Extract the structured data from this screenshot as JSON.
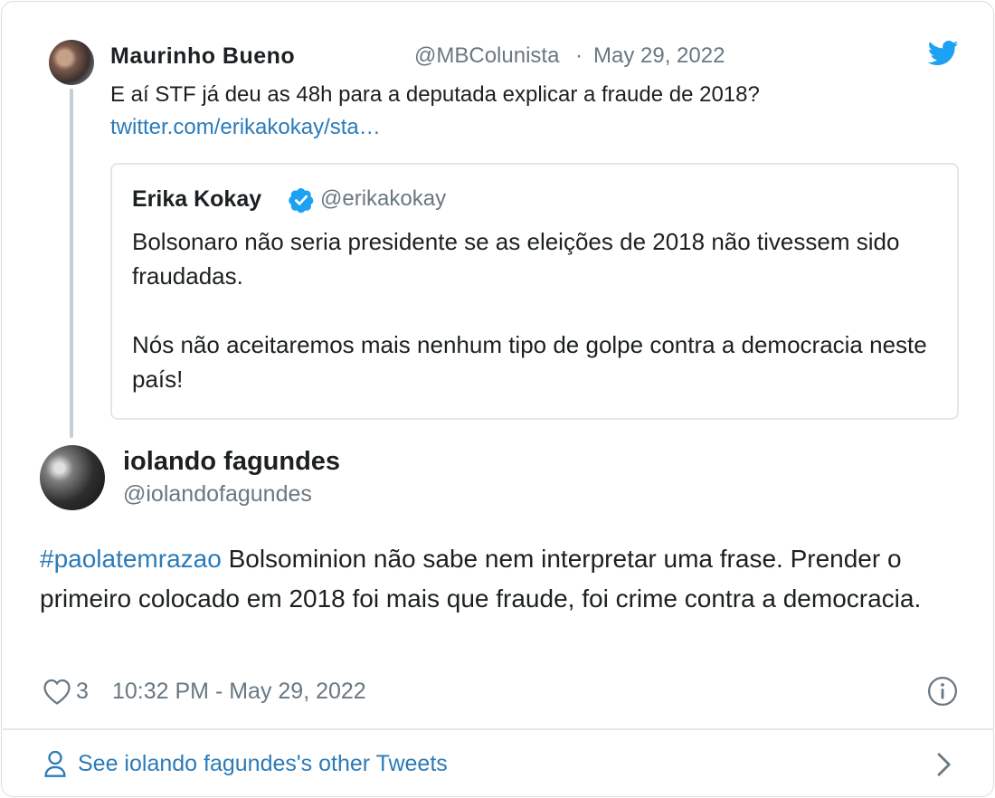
{
  "parent_tweet": {
    "author_name": "Maurinho Bueno",
    "handle": "@MBColunista",
    "separator": "·",
    "date": "May 29, 2022",
    "text": "E aí STF já deu as 48h para a deputada explicar a fraude de 2018?",
    "link": "twitter.com/erikakokay/sta…"
  },
  "quoted_tweet": {
    "author_name": "Erika Kokay",
    "handle": "@erikakokay",
    "text": "Bolsonaro não seria presidente se as eleições de 2018 não tivessem sido fraudadas.\n\nNós não aceitaremos mais nenhum tipo de golpe contra a democracia neste país!"
  },
  "main_tweet": {
    "author_name": "iolando fagundes",
    "handle": "@iolandofagundes",
    "hashtag": "#paolatemrazao",
    "text": " Bolsominion não sabe nem interpretar uma frase. Prender o primeiro colocado em 2018 foi mais que fraude, foi crime contra a democracia.",
    "like_count": "3",
    "timestamp": "10:32 PM - May 29, 2022"
  },
  "footer": {
    "see_more_label": "See iolando fagundes's other Tweets"
  },
  "colors": {
    "link": "#2b7bb9",
    "twitter_blue": "#1da1f2",
    "secondary_text": "#697882",
    "thread_line": "#c4cfd6"
  },
  "icons": [
    "twitter-bird-icon",
    "verified-badge-icon",
    "heart-icon",
    "info-icon",
    "person-icon",
    "chevron-right-icon"
  ]
}
